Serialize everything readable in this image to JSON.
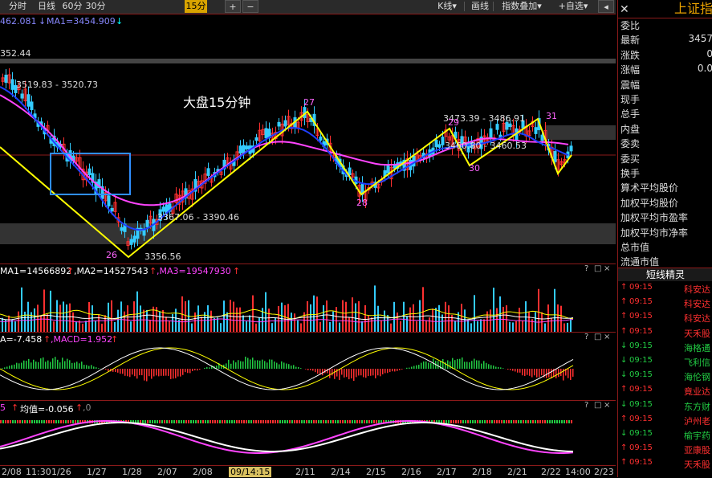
{
  "toolbar": {
    "periods": [
      "分时",
      "日线",
      "60分",
      "30分",
      "15分"
    ],
    "active_period": "15分",
    "plus": "+",
    "minus": "−",
    "kline": "K线",
    "draw": "画线",
    "index_overlay": "指数叠加",
    "self_select": "+自选"
  },
  "main": {
    "header_price": "462.081",
    "ma1": "MA1=3454.909",
    "price_label_left": "352.44",
    "annot_1": "3519.83 - 3520.73",
    "annot_title": "大盘15分钟",
    "annot_2": "3367.06 - 3390.46",
    "annot_low": "3356.56",
    "annot_3": "3473.39 - 3486.91",
    "annot_4": "3460.80 - 3460.53",
    "wave_labels": [
      "26",
      "27",
      "28",
      "29",
      "30",
      "31"
    ]
  },
  "volume": {
    "ma1": "MA1=14566892",
    "ma2": ",MA2=14527543",
    "ma3": ",MA3=19547930"
  },
  "macd": {
    "dea": "A=-7.458",
    "macd": ",MACD=1.952"
  },
  "indicator3": {
    "prefix": "5",
    "mean": "均值=-0.056",
    "suffix": ",0"
  },
  "pane_controls": [
    "?",
    "□",
    "×"
  ],
  "x_axis": {
    "labels": [
      "2/08",
      "11:30",
      "1/26",
      "1/27",
      "1/28",
      "2/07",
      "2/08",
      "09/14:15",
      "2/11",
      "2/14",
      "2/15",
      "2/16",
      "2/17",
      "2/18",
      "2/21",
      "2/22",
      "14:00",
      "2/23"
    ],
    "highlight": "09/14:15"
  },
  "right_panel": {
    "title": "上证指",
    "rows": [
      {
        "label": "委比",
        "value": ""
      },
      {
        "label": "最新",
        "value": "3457"
      },
      {
        "label": "涨跌",
        "value": "0"
      },
      {
        "label": "涨幅",
        "value": "0.0"
      },
      {
        "label": "震幅",
        "value": ""
      },
      {
        "label": "现手",
        "value": ""
      },
      {
        "label": "总手",
        "value": ""
      },
      {
        "label": "内盘",
        "value": ""
      },
      {
        "label": "委卖",
        "value": ""
      },
      {
        "label": "委买",
        "value": ""
      },
      {
        "label": "换手",
        "value": ""
      },
      {
        "label": "算术平均股价",
        "value": ""
      },
      {
        "label": "加权平均股价",
        "value": ""
      },
      {
        "label": "加权平均市盈率",
        "value": ""
      },
      {
        "label": "加权平均市净率",
        "value": ""
      },
      {
        "label": "总市值",
        "value": ""
      },
      {
        "label": "流通市值",
        "value": ""
      }
    ],
    "section_title": "短线精灵",
    "feed": [
      {
        "dir": "up",
        "time": "09:15",
        "name": "科安达"
      },
      {
        "dir": "up",
        "time": "09:15",
        "name": "科安达"
      },
      {
        "dir": "up",
        "time": "09:15",
        "name": "科安达"
      },
      {
        "dir": "up",
        "time": "09:15",
        "name": "天禾股"
      },
      {
        "dir": "down",
        "time": "09:15",
        "name": "海格通"
      },
      {
        "dir": "down",
        "time": "09:15",
        "name": "飞利信"
      },
      {
        "dir": "down",
        "time": "09:15",
        "name": "海伦钢"
      },
      {
        "dir": "up",
        "time": "09:15",
        "name": "竟业达"
      },
      {
        "dir": "down",
        "time": "09:15",
        "name": "东方财"
      },
      {
        "dir": "up",
        "time": "09:15",
        "name": "泸州老"
      },
      {
        "dir": "down",
        "time": "09:15",
        "name": "榆宇药"
      },
      {
        "dir": "up",
        "time": "09:15",
        "name": "亚康股"
      },
      {
        "dir": "up",
        "time": "09:15",
        "name": "天禾股"
      }
    ]
  },
  "colors": {
    "up": "#ff3030",
    "down": "#22cc44",
    "ma_white": "#ffffff",
    "ma_yellow": "#ffff00",
    "ma_magenta": "#ff44ff",
    "ma_blue": "#1f3fff",
    "frame": "#8b1a1a"
  }
}
